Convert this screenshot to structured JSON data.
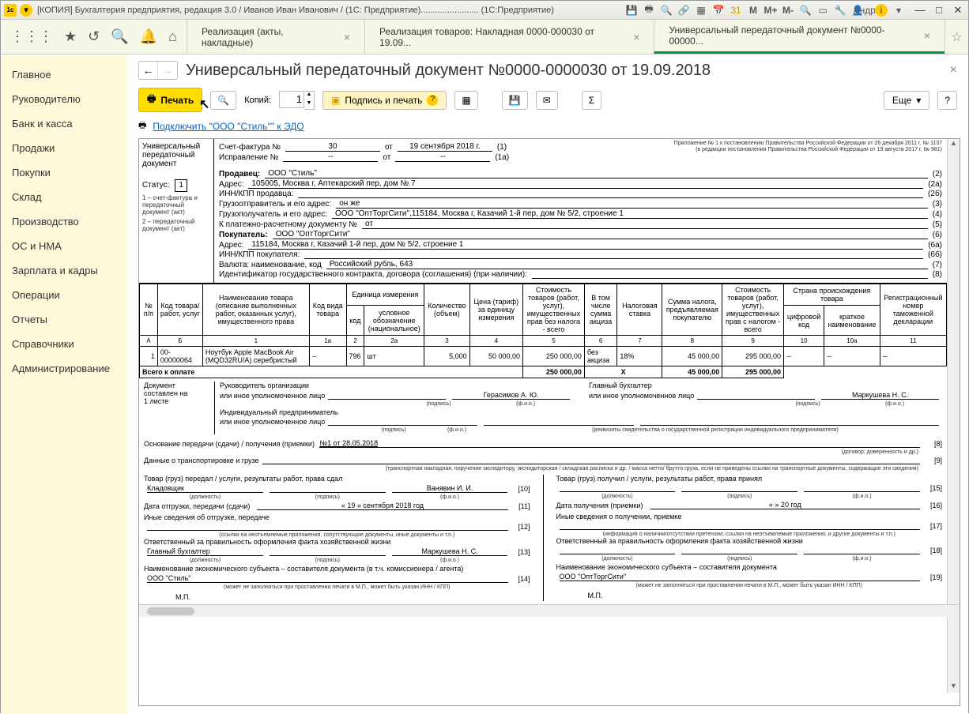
{
  "titlebar": {
    "title": "[КОПИЯ] Бухгалтерия предприятия, редакция 3.0 / Иванов Иван Иванович / (1С: Предприятие)........................   (1С:Предприятие)",
    "m1": "M",
    "m2": "M+",
    "m3": "M-",
    "user": "Андрей"
  },
  "tabs": {
    "t1": "Реализация (акты, накладные)",
    "t2": "Реализация товаров: Накладная 0000-000030 от 19.09...",
    "t3": "Универсальный передаточный документ №0000-00000..."
  },
  "sidebar": {
    "items": [
      "Главное",
      "Руководителю",
      "Банк и касса",
      "Продажи",
      "Покупки",
      "Склад",
      "Производство",
      "ОС и НМА",
      "Зарплата и кадры",
      "Операции",
      "Отчеты",
      "Справочники",
      "Администрирование"
    ]
  },
  "page": {
    "title": "Универсальный передаточный документ №0000-0000030 от 19.09.2018"
  },
  "toolbar": {
    "print": "Печать",
    "copies_lbl": "Копий:",
    "copies_val": "1",
    "sign": "Подпись и печать",
    "more": "Еще",
    "help": "?",
    "edo_link": "Подключить \"ООО \"Стиль\"\" к ЭДО"
  },
  "doc": {
    "left": {
      "l1": "Универсальный",
      "l2": "передаточный",
      "l3": "документ",
      "status_lbl": "Статус:",
      "status_val": "1",
      "fn1": "1 – счет-фактура и передаточный документ (акт)",
      "fn2": "2 – передаточный документ (акт)"
    },
    "app_note1": "Приложение № 1 к постановлению Правительства Российской Федерации от 26 декабря 2011 г. № 1137",
    "app_note2": "(в редакции постановления Правительства Российской Федерации от 19 августа 2017 г. № 981)",
    "sf_lbl": "Счет-фактура №",
    "sf_num": "30",
    "sf_ot": "от",
    "sf_date": "19 сентября 2018 г.",
    "sf_p": "(1)",
    "isp_lbl": "Исправление №",
    "isp_num": "--",
    "isp_ot": "от",
    "isp_date": "--",
    "isp_p": "(1а)",
    "seller_lbl": "Продавец:",
    "seller": "ООО \"Стиль\"",
    "seller_p": "(2)",
    "addr_lbl": "Адрес:",
    "addr": "105005, Москва г, Аптекарский пер, дом № 7",
    "addr_p": "(2а)",
    "inn_s_lbl": "ИНН/КПП продавца:",
    "inn_s_p": "(2б)",
    "shipper_lbl": "Грузоотправитель и его адрес:",
    "shipper": "он же",
    "shipper_p": "(3)",
    "consignee_lbl": "Грузополучатель и его адрес:",
    "consignee": "ООО \"ОптТоргСити\",115184, Москва г, Казачий 1-й пер, дом № 5/2, строение 1",
    "consignee_p": "(4)",
    "paydoc_lbl": "К платежно-расчетному документу №",
    "paydoc": "от",
    "paydoc_p": "(5)",
    "buyer_lbl": "Покупатель:",
    "buyer": "ООО \"ОптТоргСити\"",
    "buyer_p": "(6)",
    "baddr_lbl": "Адрес:",
    "baddr": "115184, Москва г, Казачий 1-й пер, дом № 5/2, строение 1",
    "baddr_p": "(6а)",
    "inn_b_lbl": "ИНН/КПП покупателя:",
    "inn_b_p": "(6б)",
    "cur_lbl": "Валюта: наименование, код",
    "cur": "Российский рубль, 643",
    "cur_p": "(7)",
    "gk_lbl": "Идентификатор государственного контракта, договора (соглашения) (при наличии):",
    "gk_p": "(8)"
  },
  "table": {
    "h": {
      "c1": "№ п/п",
      "c2": "Код товара/ работ, услуг",
      "c3": "Наименование товара (описание выполненных работ, оказанных услуг), имущественного права",
      "c4": "Код вида товара",
      "c5": "Единица измерения",
      "c5a": "код",
      "c5b": "условное обозначение (национальное)",
      "c6": "Количество (объем)",
      "c7": "Цена (тариф) за единицу измерения",
      "c8": "Стоимость товаров (работ, услуг), имущественных прав без налога - всего",
      "c9": "В том числе сумма акциза",
      "c10": "Налоговая ставка",
      "c11": "Сумма налога, предъявляемая покупателю",
      "c12": "Стоимость товаров (работ, услуг), имущественных прав с налогом - всего",
      "c13": "Страна происхождения товара",
      "c13a": "цифровой код",
      "c13b": "краткое наименование",
      "c14": "Регистрационный номер таможенной декларации"
    },
    "nums": {
      "a": "А",
      "b": "Б",
      "n1": "1",
      "n1a": "1а",
      "n2": "2",
      "n2a": "2а",
      "n3": "3",
      "n4": "4",
      "n5": "5",
      "n6": "6",
      "n7": "7",
      "n8": "8",
      "n9": "9",
      "n10": "10",
      "n10a": "10а",
      "n11": "11"
    },
    "row": {
      "n": "1",
      "code": "00-00000064",
      "name": "Ноутбук Apple MacBook Air (MQD32RU/A) серебристый",
      "kind": "--",
      "ucode": "796",
      "uname": "шт",
      "qty": "5,000",
      "price": "50 000,00",
      "sum": "250 000,00",
      "excise": "без акциза",
      "rate": "18%",
      "tax": "45 000,00",
      "total": "295 000,00",
      "ccode": "--",
      "cname": "--",
      "decl": "--"
    },
    "total": {
      "lbl": "Всего к оплате",
      "sum": "250 000,00",
      "x": "X",
      "tax": "45 000,00",
      "total": "295 000,00"
    }
  },
  "bottom": {
    "doc_pages1": "Документ",
    "doc_pages2": "составлен на",
    "doc_pages3": "1 листе",
    "ruk": "Руководитель организации",
    "ruk2": "или иное уполномоченное лицо",
    "ruk_name": "Герасимов А. Ю.",
    "glbuh": "Главный бухгалтер",
    "glbuh2": "или иное уполномоченное лицо",
    "glbuh_name": "Маркушева Н. С.",
    "ip": "Индивидуальный предприниматель",
    "ip2": "или иное уполномоченное лицо",
    "podpis": "(подпись)",
    "fio": "(ф.и.о.)",
    "rekv": "(реквизиты свидетельства о государственной регистрации индивидуального предпринимателя)",
    "osn_lbl": "Основание передачи (сдачи) / получения (приемки)",
    "osn_val": "№1 от 28.05.2018",
    "osn_hint": "(договор; доверенность и др.)",
    "osn_p": "[8]",
    "trans_lbl": "Данные о транспортировке и грузе",
    "trans_hint": "(транспортная накладная, поручение экспедитору, экспедиторская / складская расписка и др. / масса нетто/ брутто груза, если не приведены ссылки на транспортные документы, содержащие эти сведения)",
    "trans_p": "[9]",
    "left_col": {
      "l1": "Товар (груз) передал / услуги, результаты работ, права сдал",
      "pos": "Кладовщик",
      "name": "Ванявин И. И.",
      "p": "[10]",
      "dolzh": "(должность)",
      "date_lbl": "Дата отгрузки, передачи (сдачи)",
      "date_val": "« 19 »   сентября   2018   год",
      "date_p": "[11]",
      "other_lbl": "Иные сведения об отгрузке, передаче",
      "other_p": "[12]",
      "other_hint": "(ссылки на неотъемлемые приложения, сопутствующие документы, иные документы и т.п.)",
      "resp_lbl": "Ответственный за правильность оформления факта хозяйственной жизни",
      "resp_pos": "Главный бухгалтер",
      "resp_name": "Маркушева Н. С.",
      "resp_p": "[13]",
      "subj_lbl": "Наименование экономического субъекта – составителя документа (в т.ч. комиссионера / агента)",
      "subj_val": "ООО \"Стиль\"",
      "subj_p": "[14]",
      "subj_hint": "(может не заполняться при проставлении печати в М.П., может быть указан ИНН / КПП)",
      "mp": "М.П."
    },
    "right_col": {
      "l1": "Товар (груз) получил / услуги, результаты работ, права принял",
      "p": "[15]",
      "date_lbl": "Дата получения (приемки)",
      "date_val": "«         »                         20     год",
      "date_p": "[16]",
      "other_lbl": "Иные сведения о получении, приемке",
      "other_p": "[17]",
      "other_hint": "(информация о наличии/отсутствии претензии; ссылки на неотъемлемые приложения, и другие документы и т.п.)",
      "resp_lbl": "Ответственный за правильность оформления факта хозяйственной жизни",
      "resp_p": "[18]",
      "subj_lbl": "Наименование экономического субъекта – составителя документа",
      "subj_val": "ООО \"ОптТоргСити\"",
      "subj_p": "[19]",
      "subj_hint": "(может не заполняться при проставлении печати в М.П., может быть указан ИНН / КПП)",
      "mp": "М.П."
    }
  }
}
